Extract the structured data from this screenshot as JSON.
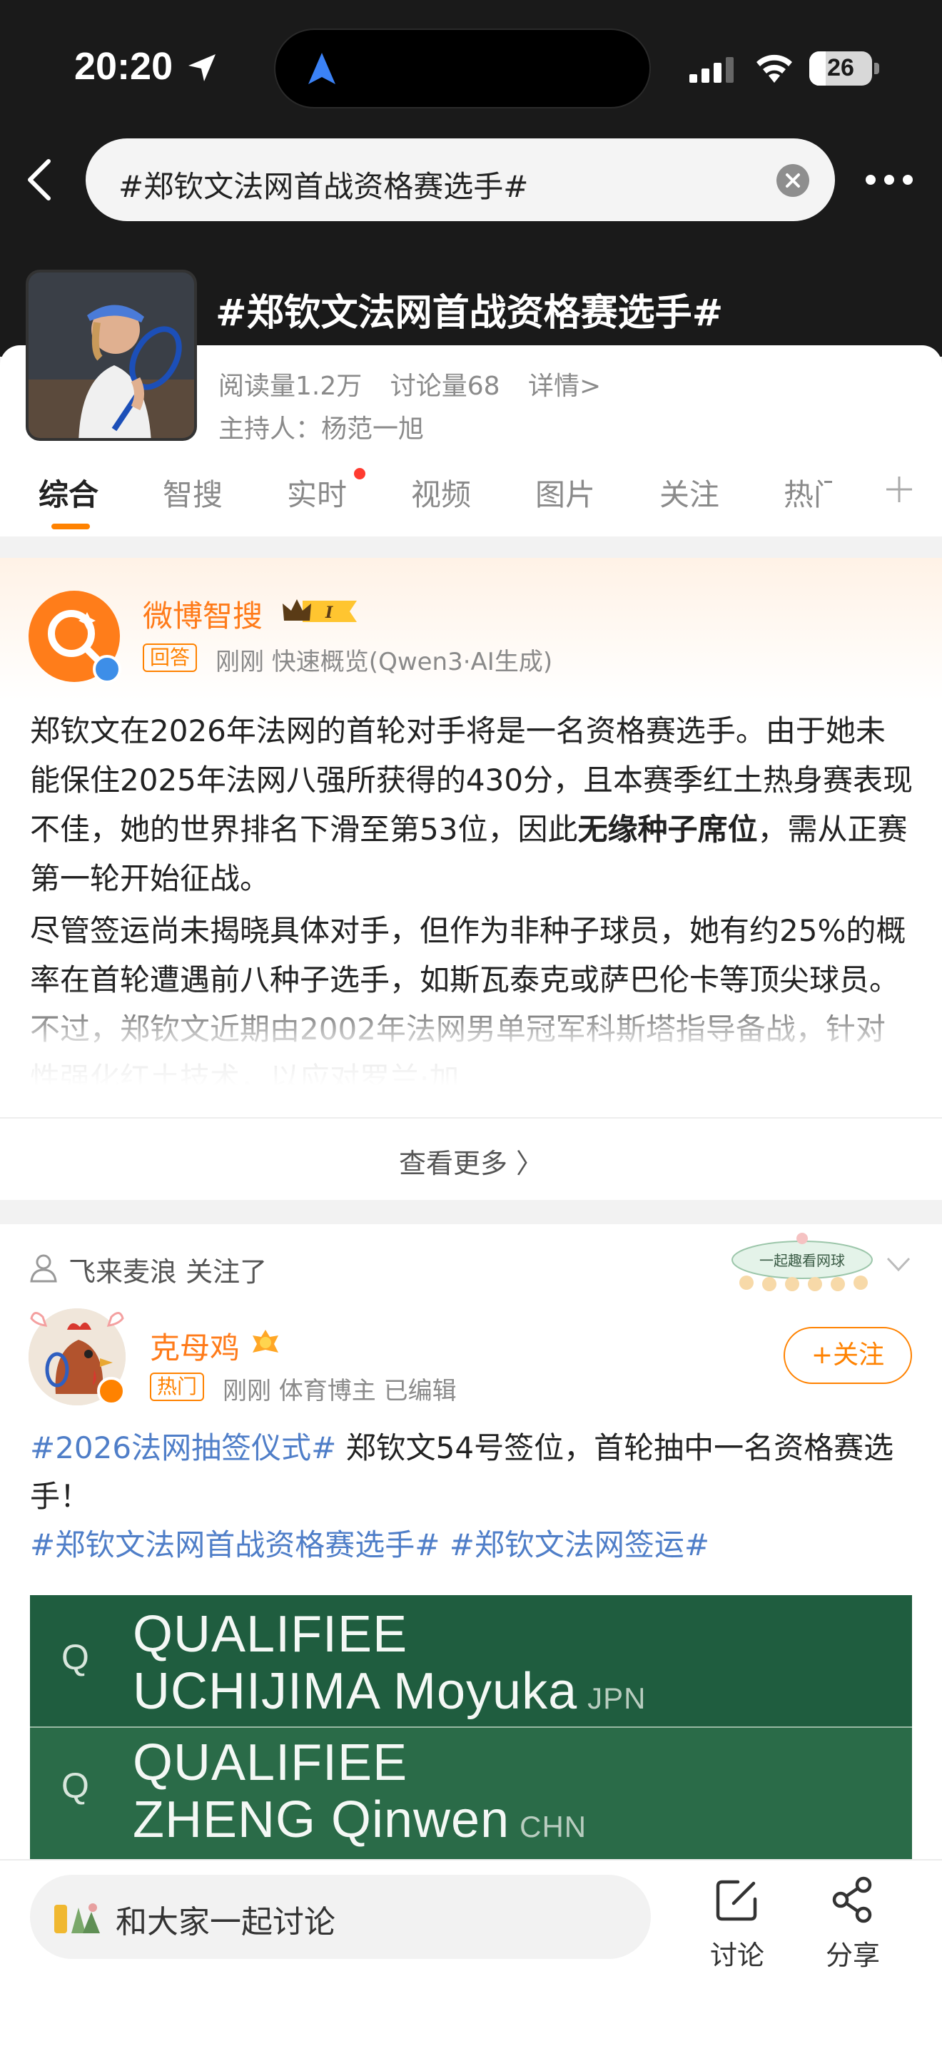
{
  "status_bar": {
    "time": "20:20",
    "battery": "26",
    "battery_level": 0.26
  },
  "search": {
    "query": "#郑钦文法网首战资格赛选手#"
  },
  "topic": {
    "title": "#郑钦文法网首战资格赛选手#",
    "reads": "阅读量1.2万",
    "discussions": "讨论量68",
    "details": "详情>",
    "host": "主持人：杨范一旭"
  },
  "tabs": [
    {
      "label": "综合"
    },
    {
      "label": "智搜"
    },
    {
      "label": "实时"
    },
    {
      "label": "视频"
    },
    {
      "label": "图片"
    },
    {
      "label": "关注"
    },
    {
      "label": "热门"
    }
  ],
  "ai_card": {
    "name": "微博智搜",
    "tag": "回答",
    "meta": "刚刚 快速概览(Qwen3·AI生成)",
    "p1_a": "郑钦文在2026年法网的首轮对手将是一名资格赛选手。由于她未能保住2025年法网八强所获得的430分，且本赛季红土热身赛表现不佳，她的世界排名下滑至第53位，因此",
    "p1_bold": "无缘种子席位",
    "p1_b": "，需从正赛第一轮开始征战。",
    "p2": "尽管签运尚未揭晓具体对手，但作为非种子球员，她有约25%的概率在首轮遭遇前八种子选手，如斯瓦泰克或萨巴伦卡等顶尖球员。不过，郑钦文近期由2002年法网男单冠军科斯塔指导备战，针对性强化红土技术，以应对罗兰·加",
    "see_more": "查看更多 〉"
  },
  "post": {
    "followed_by": "飞来麦浪 关注了",
    "badge_text": "一起趣看网球",
    "user": "克母鸡",
    "tag": "热门",
    "meta": "刚刚  体育博主  已编辑",
    "follow_label": "+关注",
    "hashtag1": "#2026法网抽签仪式#",
    "text1": " 郑钦文54号签位，首轮抽中一名资格赛选手！",
    "hashtag2": "#郑钦文法网首战资格赛选手#",
    "hashtag3": " #郑钦文法网签运#",
    "image": {
      "rows": [
        {
          "q": "Q",
          "line1": "QUALIFIEE",
          "line2": "UCHIJIMA Moyuka",
          "country": "JPN"
        },
        {
          "q": "Q",
          "line1": "QUALIFIEE",
          "line2": "ZHENG Qinwen",
          "country": "CHN"
        }
      ]
    }
  },
  "bottom_bar": {
    "placeholder": "和大家一起讨论",
    "discuss": "讨论",
    "share": "分享"
  },
  "colors": {
    "accent": "#ff8200",
    "link": "#4f7ec8",
    "header_bg": "#1a1a1a"
  }
}
